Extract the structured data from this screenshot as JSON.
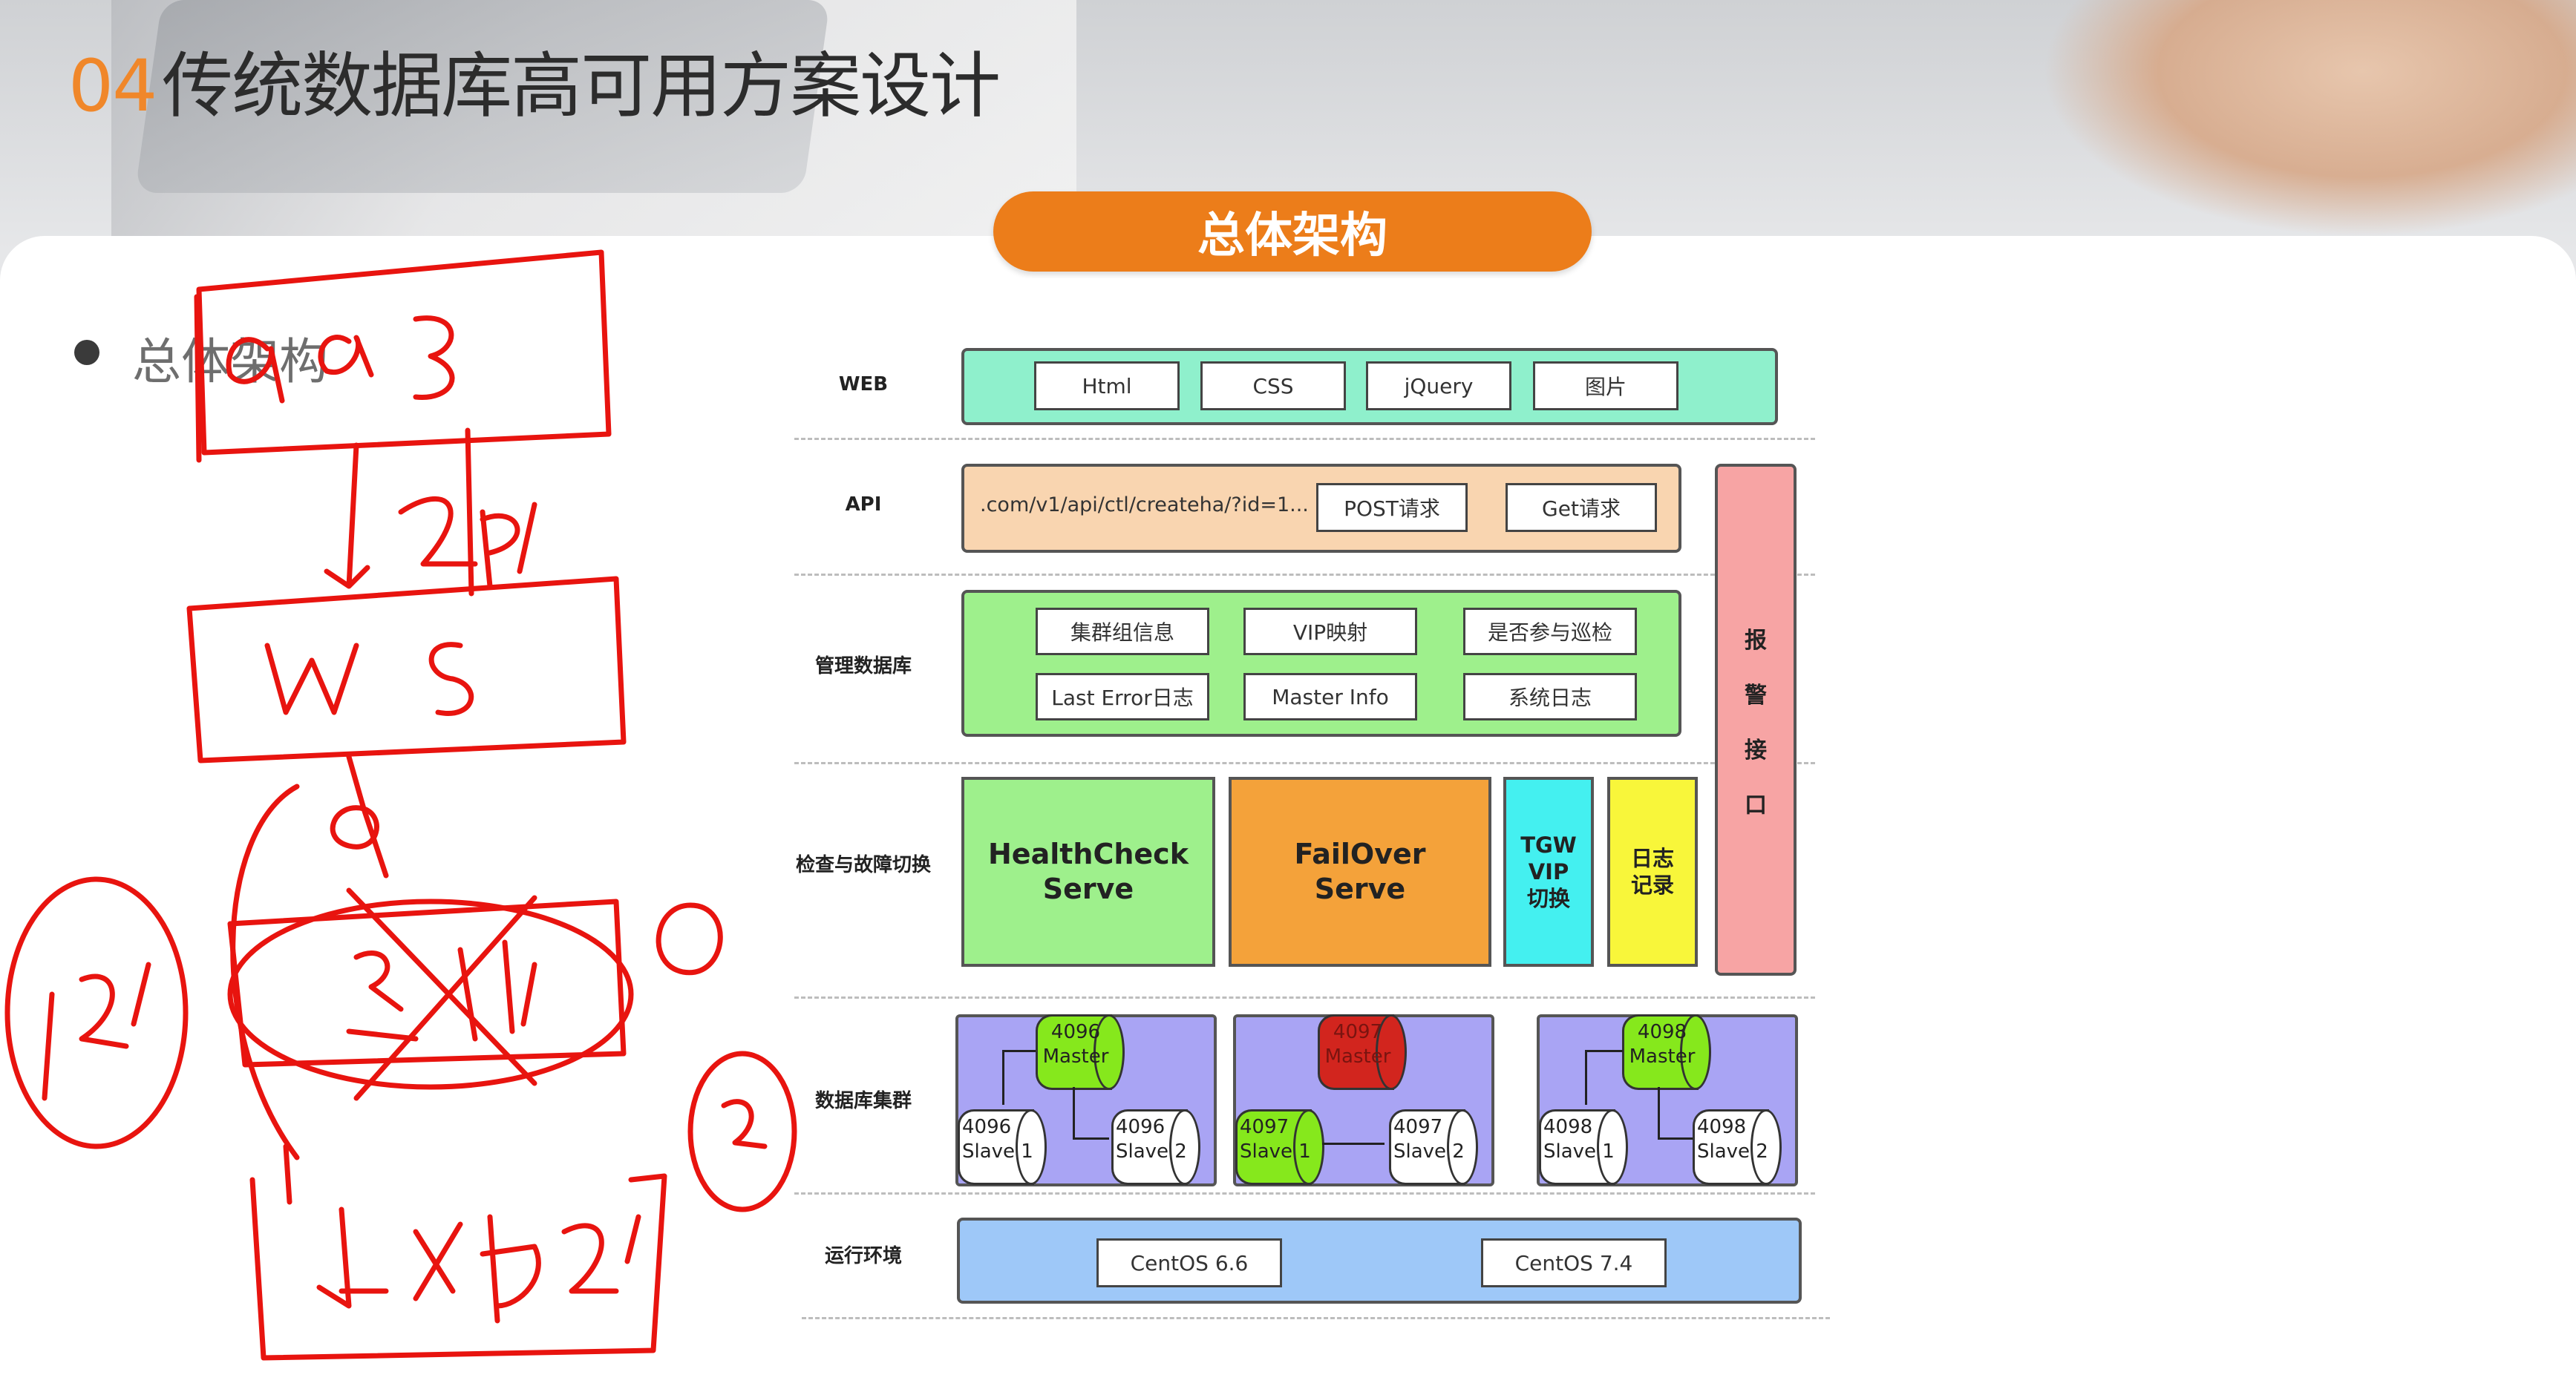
{
  "slide": {
    "number": "04",
    "title": "传统数据库高可用方案设计",
    "section_pill": "总体架构",
    "bullet": "总体架构"
  },
  "diagram": {
    "rows": {
      "web": "WEB",
      "api": "API",
      "mgmt_db": "管理数据库",
      "check": "检查与故障切换",
      "db_cluster": "数据库集群",
      "runtime": "运行环境"
    },
    "web_items": [
      "Html",
      "CSS",
      "jQuery",
      "图片"
    ],
    "api_items": {
      "url": ".com/v1/api/ctl/createha/?id=1...",
      "post": "POST请求",
      "get": "Get请求"
    },
    "mgmt_items": [
      "集群组信息",
      "VIP映射",
      "是否参与巡检",
      "Last Error日志",
      "Master Info",
      "系统日志"
    ],
    "check_items": {
      "healthcheck": "HealthCheck\nServe",
      "failover": "FailOver\nServe",
      "tgw": "TGW\nVIP\n切换",
      "log": "日志\n记录"
    },
    "alarm": [
      "报",
      "警",
      "接",
      "口"
    ],
    "clusters": [
      {
        "master": "4096\nMaster",
        "slave1": "4096\nSlave 1",
        "slave2": "4096\nSlave 2",
        "master_color": "#86e81c",
        "slave1_color": "#ffffff"
      },
      {
        "master": "4097\nMaster",
        "slave1": "4097\nSlave 1",
        "slave2": "4097\nSlave 2",
        "master_color": "#d2251e",
        "slave1_color": "#86e81c"
      },
      {
        "master": "4098\nMaster",
        "slave1": "4098\nSlave 1",
        "slave2": "4098\nSlave 2",
        "master_color": "#86e81c",
        "slave1_color": "#ffffff"
      }
    ],
    "runtime_items": [
      "CentOS 6.6",
      "CentOS 7.4"
    ]
  },
  "colors": {
    "accent_orange": "#ec7d1a",
    "web_band": "#8ff0cc",
    "api_band": "#f9d5b0",
    "mgmt_band": "#9ef08c",
    "healthcheck": "#9ef08c",
    "failover": "#f4a23a",
    "tgw": "#44f0f0",
    "log": "#f8f63a",
    "alarm": "#f7a4a4",
    "cluster": "#a9a4f4",
    "runtime": "#9ec8f8",
    "ink_red": "#e8140f"
  },
  "annotations_icon": "handwritten-red-ink-sketch"
}
